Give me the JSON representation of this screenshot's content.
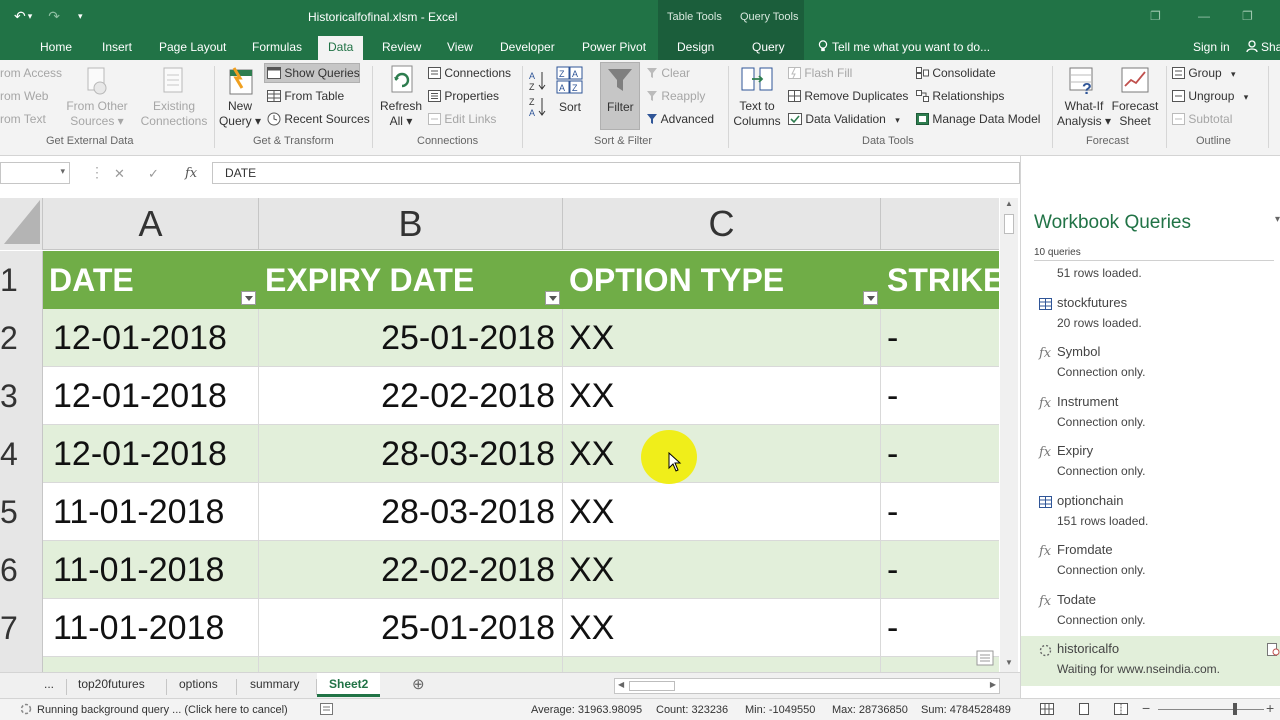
{
  "window": {
    "title": "Historicalfofinal.xlsm - Excel",
    "context_groups": [
      "Table Tools",
      "Query Tools"
    ],
    "restore_glyph": "❐",
    "minimize_glyph": "—"
  },
  "qat": {
    "save_icon": "save-icon",
    "undo_glyph": "↶",
    "undo_drop": "▾",
    "redo_glyph": "↷",
    "customize_glyph": "▾"
  },
  "tabs": [
    "Home",
    "Insert",
    "Page Layout",
    "Formulas",
    "Data",
    "Review",
    "View",
    "Developer",
    "Power Pivot",
    "Design",
    "Query"
  ],
  "active_tab": "Data",
  "tell_me": "Tell me what you want to do...",
  "sign_in": "Sign in",
  "share": "Sha",
  "ribbon": {
    "get_external_data": {
      "label": "Get External Data",
      "from_access": "rom Access",
      "from_web": "rom Web",
      "from_text": "rom Text",
      "from_other_1": "From Other",
      "from_other_2": "Sources",
      "existing_1": "Existing",
      "existing_2": "Connections"
    },
    "get_transform": {
      "label": "Get & Transform",
      "new_query_1": "New",
      "new_query_2": "Query",
      "show_queries": "Show Queries",
      "from_table": "From Table",
      "recent_sources": "Recent Sources"
    },
    "connections": {
      "label": "Connections",
      "refresh_1": "Refresh",
      "refresh_2": "All",
      "connections": "Connections",
      "properties": "Properties",
      "edit_links": "Edit Links"
    },
    "sort_filter": {
      "label": "Sort & Filter",
      "sort": "Sort",
      "filter": "Filter",
      "clear": "Clear",
      "reapply": "Reapply",
      "advanced": "Advanced"
    },
    "data_tools": {
      "label": "Data Tools",
      "text_to_1": "Text to",
      "text_to_2": "Columns",
      "flash_fill": "Flash Fill",
      "remove_duplicates": "Remove Duplicates",
      "data_validation": "Data Validation",
      "consolidate": "Consolidate",
      "relationships": "Relationships",
      "manage_data_model": "Manage Data Model"
    },
    "forecast": {
      "label": "Forecast",
      "what_if_1": "What-If",
      "what_if_2": "Analysis",
      "forecast_sheet_1": "Forecast",
      "forecast_sheet_2": "Sheet"
    },
    "outline": {
      "label": "Outline",
      "group": "Group",
      "ungroup": "Ungroup",
      "subtotal": "Subtotal"
    }
  },
  "formula_bar": {
    "cancel": "✕",
    "enter": "✓",
    "fx": "fx",
    "value": "DATE"
  },
  "columns": [
    "A",
    "B",
    "C"
  ],
  "table": {
    "headers": [
      "DATE",
      "EXPIRY DATE",
      "OPTION TYPE",
      "STRIKE"
    ],
    "row_numbers": [
      "1",
      "2",
      "3",
      "4",
      "5",
      "6",
      "7"
    ],
    "rows": [
      [
        "12-01-2018",
        "25-01-2018",
        "XX",
        "-"
      ],
      [
        "12-01-2018",
        "22-02-2018",
        "XX",
        "-"
      ],
      [
        "12-01-2018",
        "28-03-2018",
        "XX",
        "-"
      ],
      [
        "11-01-2018",
        "28-03-2018",
        "XX",
        "-"
      ],
      [
        "11-01-2018",
        "22-02-2018",
        "XX",
        "-"
      ],
      [
        "11-01-2018",
        "25-01-2018",
        "XX",
        "-"
      ]
    ]
  },
  "sheets": {
    "more": "...",
    "tabs": [
      "top20futures",
      "options",
      "summary",
      "Sheet2"
    ],
    "active": "Sheet2",
    "add": "⊕"
  },
  "status": {
    "message": "Running background query ...  (Click here to cancel)",
    "average": "Average: 31963.98095",
    "count": "Count: 323236",
    "min": "Min: -1049550",
    "max": "Max: 28736850",
    "sum": "Sum: 4784528489"
  },
  "queries_pane": {
    "title": "Workbook Queries",
    "count": "10 queries",
    "partial_status": "51 rows loaded.",
    "items": [
      {
        "name": "stockfutures",
        "status": "20 rows loaded.",
        "icon": "table-icon"
      },
      {
        "name": "Symbol",
        "status": "Connection only.",
        "icon": "function-icon"
      },
      {
        "name": "Instrument",
        "status": "Connection only.",
        "icon": "function-icon"
      },
      {
        "name": "Expiry",
        "status": "Connection only.",
        "icon": "function-icon"
      },
      {
        "name": "optionchain",
        "status": "151 rows loaded.",
        "icon": "table-icon"
      },
      {
        "name": "Fromdate",
        "status": "Connection only.",
        "icon": "function-icon"
      },
      {
        "name": "Todate",
        "status": "Connection only.",
        "icon": "function-icon"
      },
      {
        "name": "historicalfo",
        "status": "Waiting for www.nseindia.com.",
        "icon": "loading-icon"
      }
    ]
  },
  "colors": {
    "excel_green": "#217346",
    "table_header": "#70ad47",
    "band": "#e2efda",
    "cursor_highlight": "#f0ee1a"
  }
}
